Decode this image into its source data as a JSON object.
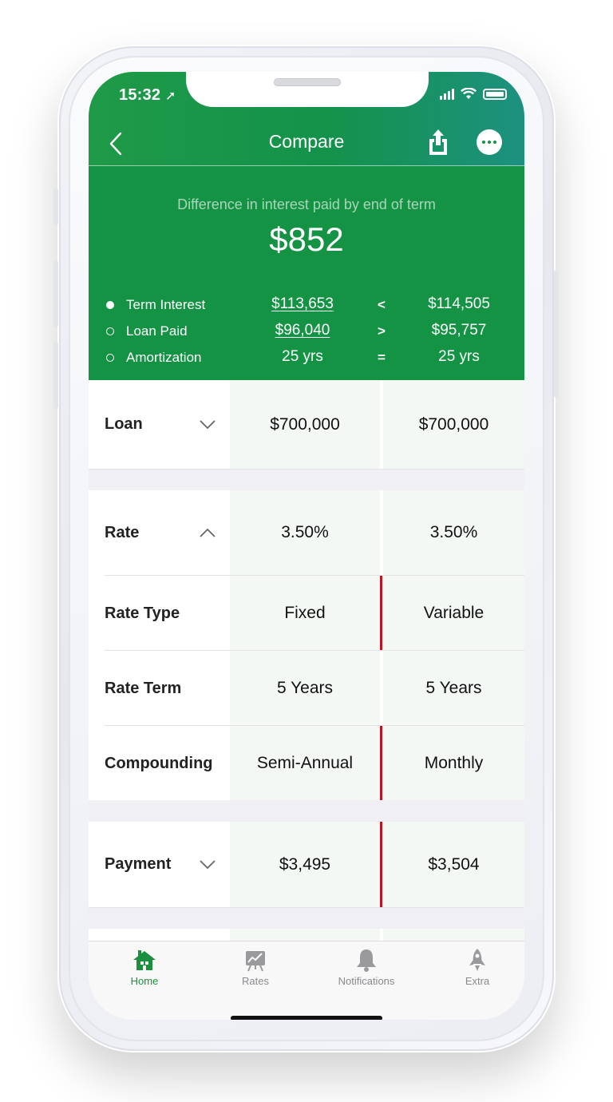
{
  "status": {
    "time": "15:32"
  },
  "nav": {
    "title": "Compare"
  },
  "summary": {
    "diff_label": "Difference in interest paid by end of term",
    "diff_amount": "$852",
    "rows": [
      {
        "label": "Term Interest",
        "v1": "$113,653",
        "op": "<",
        "v2": "$114,505",
        "selected": true
      },
      {
        "label": "Loan Paid",
        "v1": "$96,040",
        "op": ">",
        "v2": "$95,757",
        "selected": false
      },
      {
        "label": "Amortization",
        "v1": "25 yrs",
        "op": "=",
        "v2": "25 yrs",
        "selected": false
      }
    ]
  },
  "table": {
    "loan": {
      "label": "Loan",
      "a": "$700,000",
      "b": "$700,000"
    },
    "rate": {
      "label": "Rate",
      "a": "3.50%",
      "b": "3.50%"
    },
    "rate_type": {
      "label": "Rate Type",
      "a": "Fixed",
      "b": "Variable"
    },
    "rate_term": {
      "label": "Rate Term",
      "a": "5 Years",
      "b": "5 Years"
    },
    "compounding": {
      "label": "Compounding",
      "a": "Semi-Annual",
      "b": "Monthly"
    },
    "payment": {
      "label": "Payment",
      "a": "$3,495",
      "b": "$3,504"
    }
  },
  "tabs": [
    {
      "label": "Home",
      "icon": "house-icon",
      "active": true
    },
    {
      "label": "Rates",
      "icon": "chart-board-icon",
      "active": false
    },
    {
      "label": "Notifications",
      "icon": "bell-icon",
      "active": false
    },
    {
      "label": "Extra",
      "icon": "rocket-icon",
      "active": false
    }
  ],
  "colors": {
    "brand_green": "#149344",
    "diff_marker": "#c4121f",
    "tab_active": "#1c8f3f"
  }
}
